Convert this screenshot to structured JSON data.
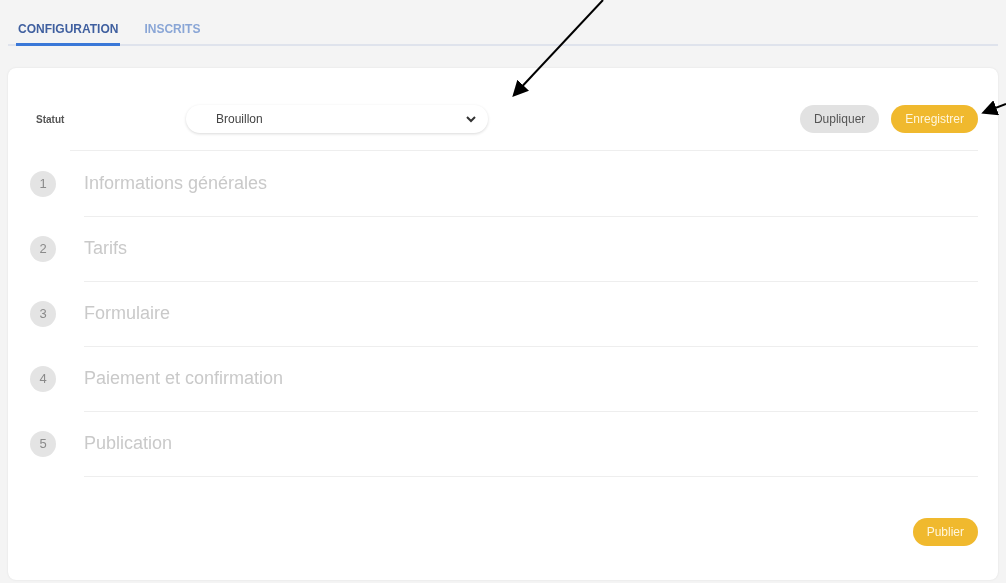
{
  "tabs": [
    {
      "label": "CONFIGURATION",
      "selected": true
    },
    {
      "label": "INSCRITS",
      "selected": false
    }
  ],
  "status": {
    "label": "Statut",
    "value": "Brouillon"
  },
  "actions": [
    {
      "label": "Dupliquer",
      "kind": "secondary"
    },
    {
      "label": "Enregistrer",
      "kind": "primary"
    }
  ],
  "steps": [
    {
      "number": "1",
      "title": "Informations générales"
    },
    {
      "number": "2",
      "title": "Tarifs"
    },
    {
      "number": "3",
      "title": "Formulaire"
    },
    {
      "number": "4",
      "title": "Paiement et confirmation"
    },
    {
      "number": "5",
      "title": "Publication"
    }
  ],
  "publish_button": {
    "label": "Publier"
  }
}
